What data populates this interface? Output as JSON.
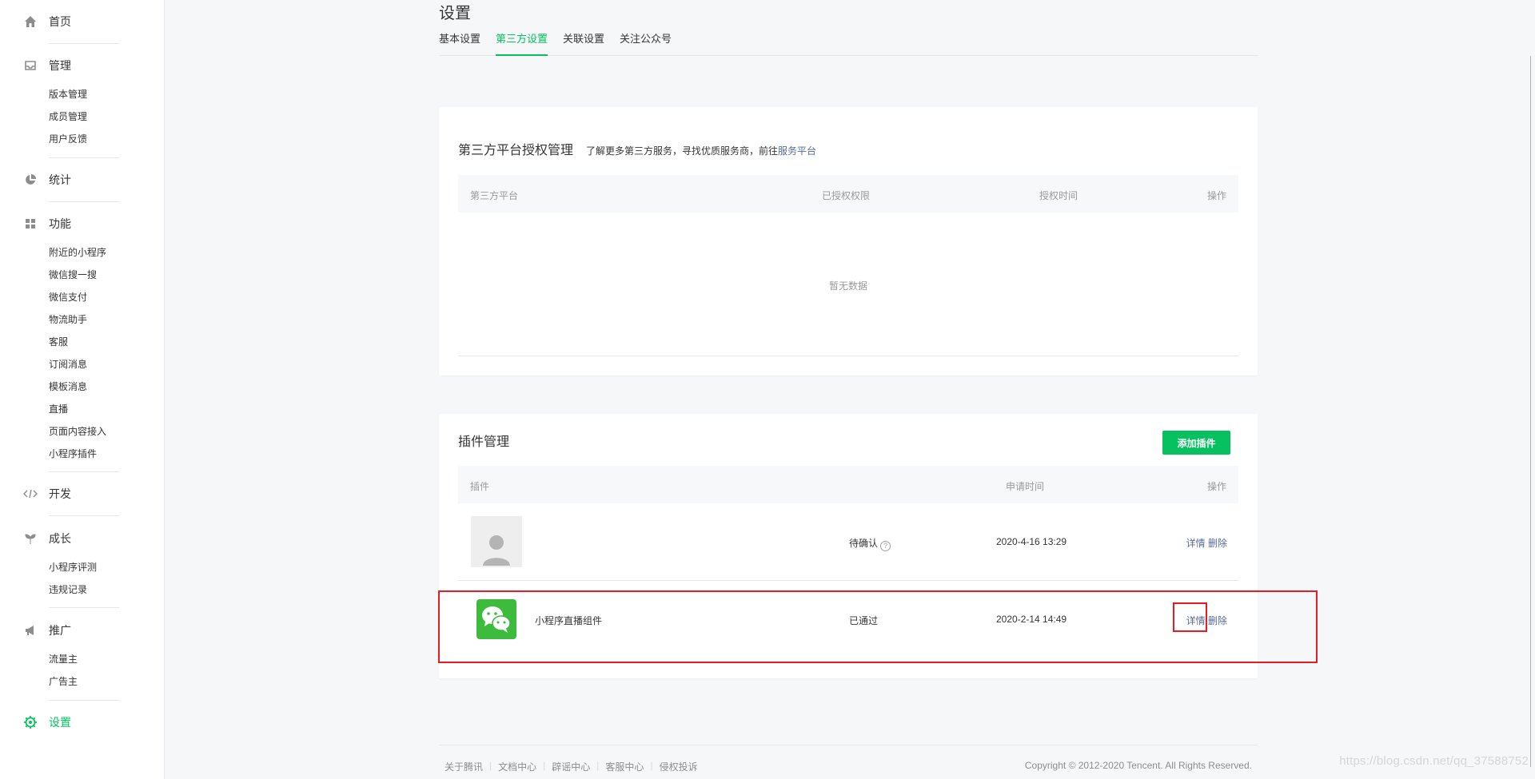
{
  "sidebar": {
    "home": "首页",
    "manage": {
      "label": "管理",
      "items": [
        "版本管理",
        "成员管理",
        "用户反馈"
      ]
    },
    "stats": "统计",
    "features": {
      "label": "功能",
      "items": [
        "附近的小程序",
        "微信搜一搜",
        "微信支付",
        "物流助手",
        "客服",
        "订阅消息",
        "模板消息",
        "直播",
        "页面内容接入",
        "小程序插件"
      ]
    },
    "dev": "开发",
    "growth": {
      "label": "成长",
      "items": [
        "小程序评测",
        "违规记录"
      ]
    },
    "promo": {
      "label": "推广",
      "items": [
        "流量主",
        "广告主"
      ]
    },
    "settings": "设置"
  },
  "page": {
    "title": "设置",
    "tabs": [
      "基本设置",
      "第三方设置",
      "关联设置",
      "关注公众号"
    ],
    "active_tab": "第三方设置"
  },
  "third_party": {
    "title": "第三方平台授权管理",
    "desc_prefix": "了解更多第三方服务，寻找优质服务商，前往",
    "desc_link": "服务平台",
    "columns": [
      "第三方平台",
      "已授权权限",
      "授权时间",
      "操作"
    ],
    "empty": "暂无数据"
  },
  "plugins": {
    "title": "插件管理",
    "add_button": "添加插件",
    "columns": [
      "插件",
      "申请时间",
      "操作"
    ],
    "rows": [
      {
        "name": "",
        "status": "待确认",
        "time": "2020-4-16 13:29",
        "detail": "详情",
        "delete": "删除"
      },
      {
        "name": "小程序直播组件",
        "status": "已通过",
        "time": "2020-2-14 14:49",
        "detail": "详情",
        "delete": "删除"
      }
    ]
  },
  "footer": {
    "links": [
      "关于腾讯",
      "文档中心",
      "辟谣中心",
      "客服中心",
      "侵权投诉"
    ],
    "copyright": "Copyright © 2012-2020 Tencent. All Rights Reserved.",
    "watermark": "https://blog.csdn.net/qq_37588752"
  },
  "colors": {
    "accent": "#07c160",
    "link": "#576b95",
    "highlight": "#e51c23"
  }
}
